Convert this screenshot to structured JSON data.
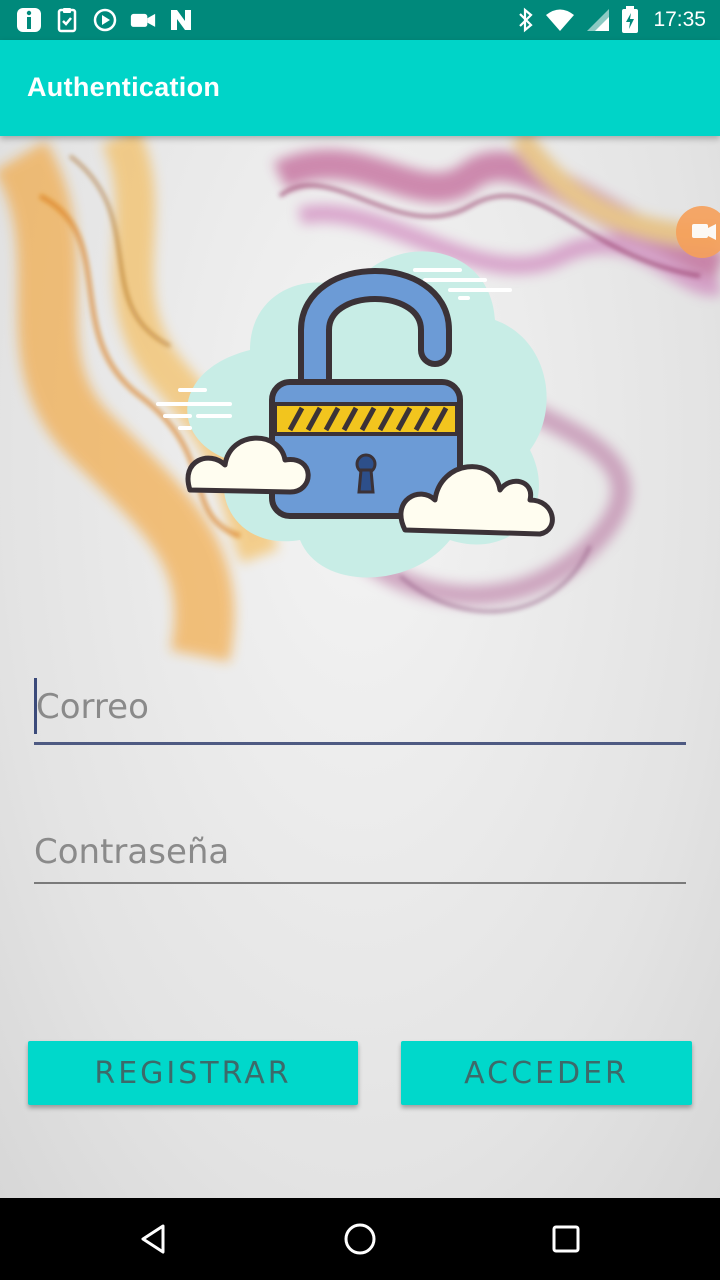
{
  "status_bar": {
    "time": "17:35",
    "left_icons": [
      "info-icon",
      "clipboard-icon",
      "play-icon",
      "video-icon",
      "n-logo-icon"
    ],
    "right_icons": [
      "bluetooth-icon",
      "wifi-icon",
      "signal-icon",
      "battery-icon"
    ]
  },
  "app_bar": {
    "title": "Authentication"
  },
  "form": {
    "email_placeholder": "Correo",
    "password_placeholder": "Contraseña"
  },
  "buttons": {
    "register_label": "REGISTRAR",
    "login_label": "ACCEDER"
  },
  "colors": {
    "accent": "#00d4c8",
    "status_bar": "#00897b",
    "lock_body": "#6c9bd6",
    "lock_stripe": "#f2c51e",
    "cloud_backdrop": "#c8ede6"
  },
  "nav_bar": {
    "icons": [
      "back-icon",
      "home-icon",
      "recents-icon"
    ]
  }
}
